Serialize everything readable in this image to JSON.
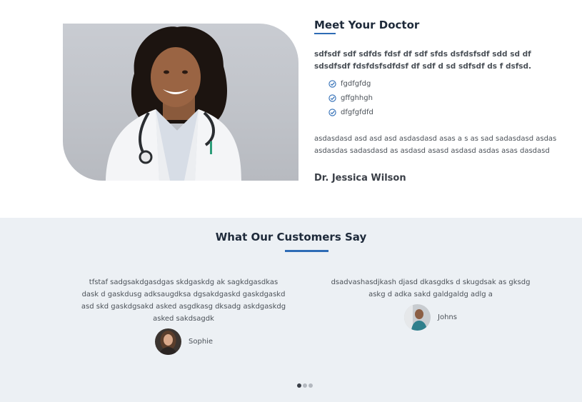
{
  "doctor": {
    "title": "Meet Your Doctor",
    "lead": "sdfsdf sdf sdfds fdsf df sdf sfds dsfdsfsdf sdd sd df sdsdfsdf fdsfdsfsdfdsf df sdf d sd sdfsdf ds f dsfsd.",
    "checklist": [
      "fgdfgfdg",
      "gffghhgh",
      "dfgfgfdfd"
    ],
    "paragraph": "asdasdasd asd asd asd asdasdasd asas a s as sad sadasdasd asdas asdasdas sadasdasd as asdasd asasd asdasd asdas asas dasdasd",
    "name": "Dr. Jessica Wilson",
    "photo_icon": "doctor-portrait"
  },
  "testimonials": {
    "title": "What Our Customers Say",
    "items": [
      {
        "text": "tfstaf sadgsakdgasdgas skdgaskdg ak sagkdgasdkas dask d gaskdusg adksaugdksa dgsakdgaskd gaskdgaskd asd skd gaskdgsakd asked asgdkasg dksadg askdgaskdg asked sakdsagdk",
        "author": "Sophie"
      },
      {
        "text": "dsadvashasdjkash djasd dkasgdks d skugdsak as gksdg askg d adka sakd galdgaldg adlg a",
        "author": "Johns"
      }
    ],
    "pagination": {
      "count": 3,
      "active": 1
    }
  },
  "colors": {
    "accent": "#2e6cb5",
    "section_bg": "#ecf0f4",
    "heading": "#1e2a3a"
  }
}
